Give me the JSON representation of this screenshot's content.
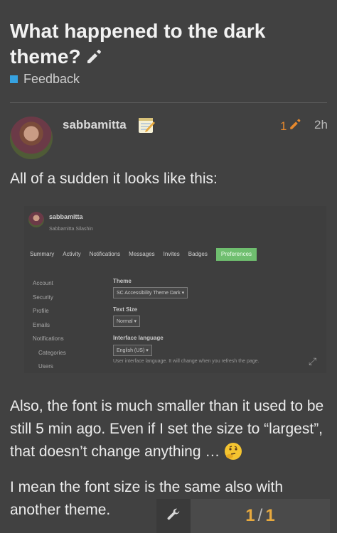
{
  "topic": {
    "title": "What happened to the dark theme?",
    "category": "Feedback",
    "category_color": "#36a2e0"
  },
  "post": {
    "username": "sabbamitta",
    "edit_count": "1",
    "age": "2h",
    "paragraph1": "All of a sudden it looks like this:",
    "paragraph2": "Also, the font is much smaller than it used to be still 5 min ago. Even if I set the size to “largest”, that doesn’t change anything …",
    "paragraph3": "I mean the font size is the same also with another theme."
  },
  "screenshot": {
    "username": "sabbamitta",
    "full_name": "Sabbamitta Silashin",
    "nav": [
      "Summary",
      "Activity",
      "Notifications",
      "Messages",
      "Invites",
      "Badges",
      "Preferences"
    ],
    "sidebar": [
      "Account",
      "Security",
      "Profile",
      "Emails",
      "Notifications",
      "Categories",
      "Users"
    ],
    "theme_label": "Theme",
    "theme_value": "SC Accessibility Theme Dark",
    "text_size_label": "Text Size",
    "text_size_value": "Normal",
    "language_label": "Interface language",
    "language_value": "English (US)",
    "language_hint": "User interface language. It will change when you refresh the page."
  },
  "footer": {
    "page_current": "1",
    "page_sep": "/",
    "page_total": "1"
  },
  "colors": {
    "accent": "#e7892d",
    "pager": "#e7a93e",
    "preferences_tab": "#6fbe6f"
  }
}
